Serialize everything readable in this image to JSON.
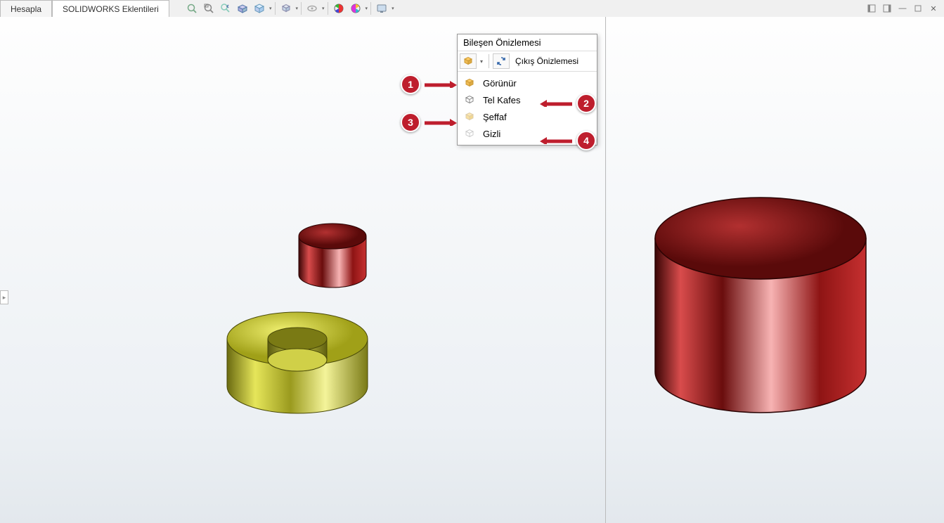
{
  "tabs": {
    "calculate": "Hesapla",
    "addins": "SOLIDWORKS Eklentileri"
  },
  "popup": {
    "title": "Bileşen Önizlemesi",
    "exit_label": "Çıkış Önizlemesi",
    "items": {
      "visible": "Görünür",
      "wireframe": "Tel Kafes",
      "transparent": "Şeffaf",
      "hidden": "Gizli"
    }
  },
  "callouts": {
    "c1": "1",
    "c2": "2",
    "c3": "3",
    "c4": "4"
  }
}
